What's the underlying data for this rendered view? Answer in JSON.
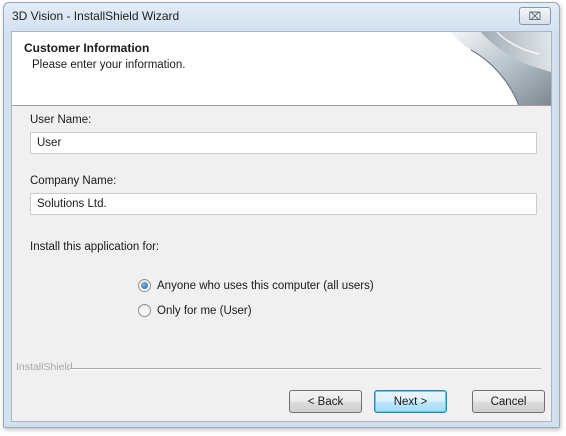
{
  "window": {
    "title": "3D Vision - InstallShield Wizard",
    "close_symbol": "⌧"
  },
  "header": {
    "title": "Customer Information",
    "subtitle": "Please enter your information."
  },
  "form": {
    "user_name_label": "User Name:",
    "user_name_value": "User",
    "company_name_label": "Company Name:",
    "company_name_value": "Solutions Ltd.",
    "install_for_label": "Install this application for:",
    "options": [
      {
        "label": "Anyone who uses this computer (all users)",
        "selected": true
      },
      {
        "label": "Only for me (User)",
        "selected": false
      }
    ]
  },
  "footer": {
    "brand": "InstallShield",
    "back_label": "< Back",
    "next_label": "Next >",
    "cancel_label": "Cancel"
  },
  "colors": {
    "title_bar": "#d3e1ef",
    "dialog_bg": "#f0f0f0",
    "default_button_border": "#3c7fb1"
  }
}
